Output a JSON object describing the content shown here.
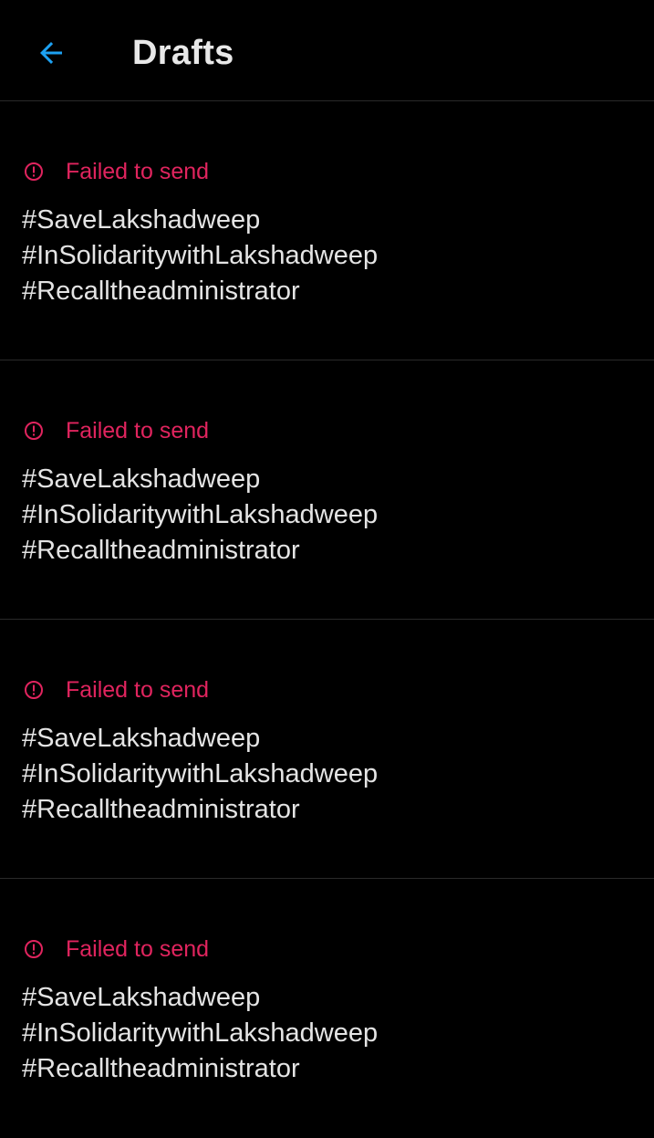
{
  "header": {
    "title": "Drafts",
    "back_icon": "arrow-left-icon",
    "accent_color": "#1da1f2"
  },
  "drafts": [
    {
      "status": "Failed to send",
      "status_icon": "error-circle-icon",
      "text": "#SaveLakshadweep\n#InSolidaritywithLakshadweep\n#Recalltheadministrator"
    },
    {
      "status": "Failed to send",
      "status_icon": "error-circle-icon",
      "text": "#SaveLakshadweep\n#InSolidaritywithLakshadweep\n#Recalltheadministrator"
    },
    {
      "status": "Failed to send",
      "status_icon": "error-circle-icon",
      "text": "#SaveLakshadweep\n#InSolidaritywithLakshadweep\n#Recalltheadministrator"
    },
    {
      "status": "Failed to send",
      "status_icon": "error-circle-icon",
      "text": "#SaveLakshadweep\n#InSolidaritywithLakshadweep\n#Recalltheadministrator"
    }
  ],
  "colors": {
    "background": "#000000",
    "error": "#e0245e",
    "text": "#e4e4e4",
    "divider": "#2a2a2a"
  }
}
